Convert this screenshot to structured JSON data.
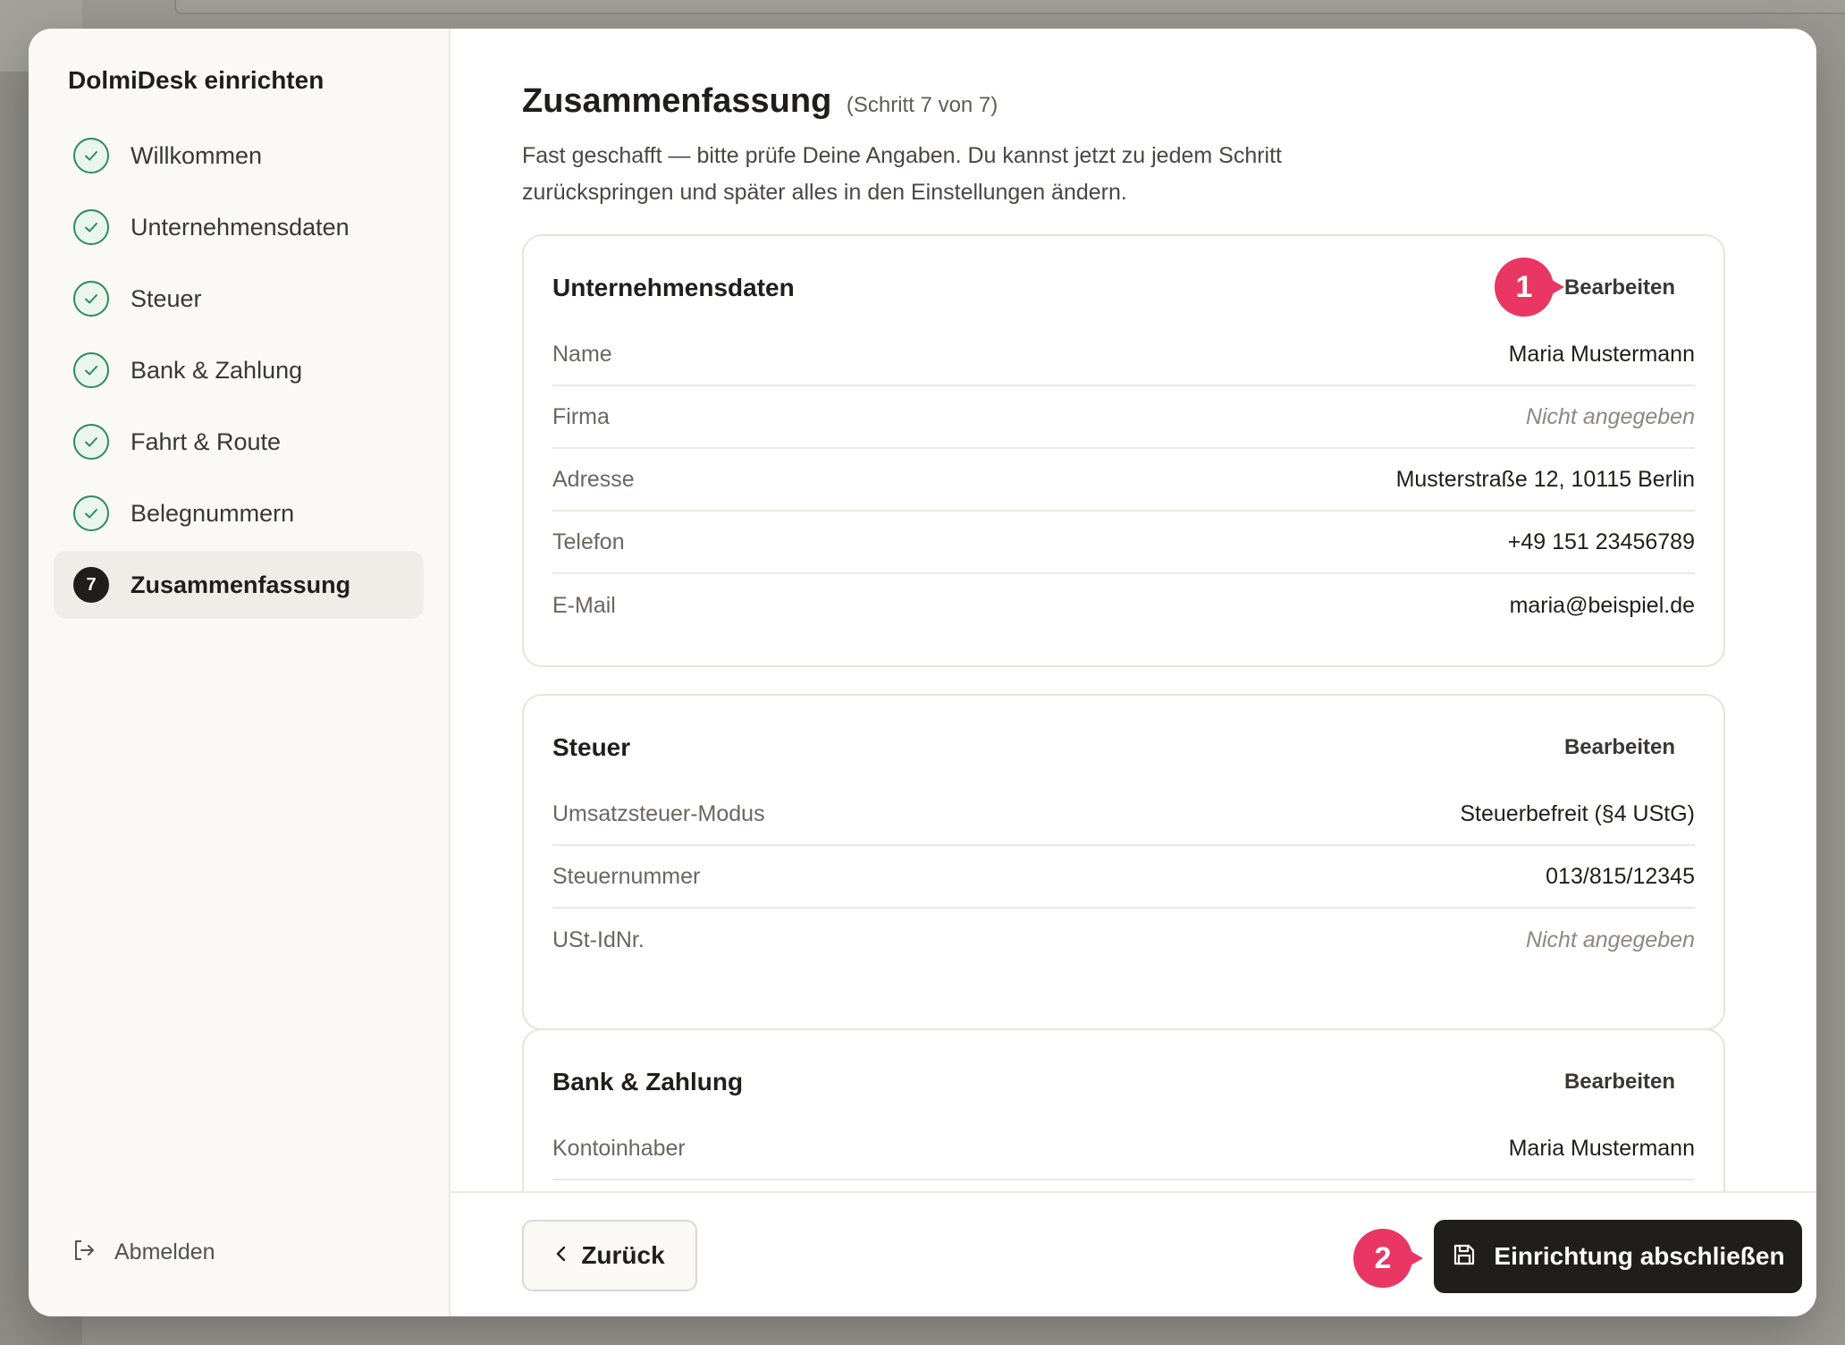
{
  "sidebar": {
    "title": "DolmiDesk einrichten",
    "steps": [
      {
        "label": "Willkommen",
        "status": "done"
      },
      {
        "label": "Unternehmensdaten",
        "status": "done"
      },
      {
        "label": "Steuer",
        "status": "done"
      },
      {
        "label": "Bank & Zahlung",
        "status": "done"
      },
      {
        "label": "Fahrt & Route",
        "status": "done"
      },
      {
        "label": "Belegnummern",
        "status": "done"
      },
      {
        "label": "Zusammenfassung",
        "status": "active",
        "number": "7"
      }
    ],
    "logout_label": "Abmelden"
  },
  "main": {
    "title": "Zusammenfassung",
    "step_info": "(Schritt 7 von 7)",
    "intro": "Fast geschafft — bitte prüfe Deine Angaben. Du kannst jetzt zu jedem Schritt zurückspringen und später alles in den Einstellungen ändern.",
    "edit_label": "Bearbeiten",
    "sections": [
      {
        "title": "Unternehmensdaten",
        "rows": [
          {
            "key": "Name",
            "value": "Maria Mustermann"
          },
          {
            "key": "Firma",
            "value": "Nicht angegeben"
          },
          {
            "key": "Adresse",
            "value": "Musterstraße 12, 10115 Berlin"
          },
          {
            "key": "Telefon",
            "value": "+49 151 23456789"
          },
          {
            "key": "E-Mail",
            "value": "maria@beispiel.de"
          }
        ]
      },
      {
        "title": "Steuer",
        "rows": [
          {
            "key": "Umsatzsteuer-Modus",
            "value": "Steuerbefreit (§4 UStG)"
          },
          {
            "key": "Steuernummer",
            "value": "013/815/12345"
          },
          {
            "key": "USt-IdNr.",
            "value": "Nicht angegeben"
          }
        ]
      },
      {
        "title": "Bank & Zahlung",
        "rows": [
          {
            "key": "Kontoinhaber",
            "value": "Maria Mustermann"
          }
        ]
      }
    ]
  },
  "footer": {
    "back_label": "Zurück",
    "finish_label": "Einrichtung abschließen"
  },
  "markers": [
    "1",
    "2"
  ],
  "colors": {
    "accent_dark": "#1f1e1b",
    "success": "#2f8a5a",
    "marker": "#e93662"
  }
}
